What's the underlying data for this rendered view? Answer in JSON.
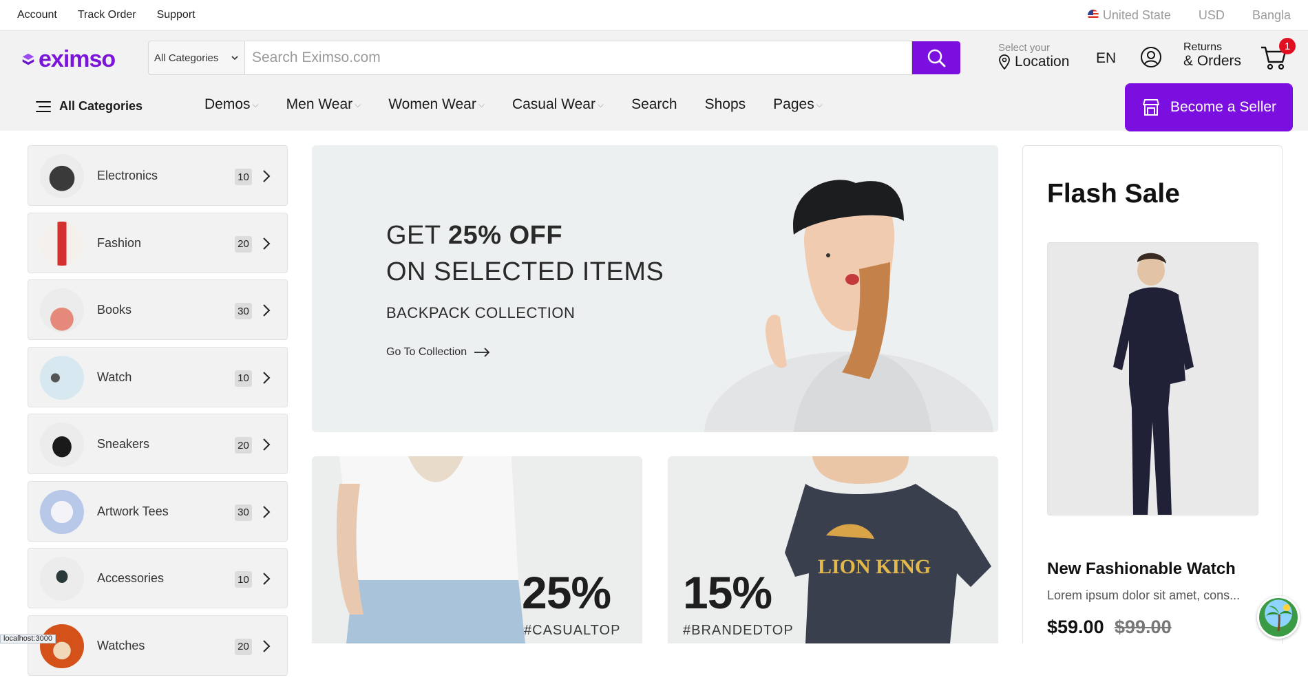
{
  "topbar": {
    "links": [
      "Account",
      "Track Order",
      "Support"
    ],
    "country": "United State",
    "currency": "USD",
    "language": "Bangla"
  },
  "header": {
    "logo_text": "eximso",
    "category_select": "All Categories",
    "search_placeholder": "Search Eximso.com",
    "location_small": "Select your",
    "location_big": "Location",
    "lang_code": "EN",
    "orders_small": "Returns",
    "orders_big": "& Orders",
    "cart_count": "1"
  },
  "nav": {
    "all_categories": "All Categories",
    "items": [
      "Demos",
      "Men Wear",
      "Women Wear",
      "Casual Wear",
      "Search",
      "Shops",
      "Pages"
    ],
    "seller_button": "Become a Seller"
  },
  "categories": [
    {
      "name": "Electronics",
      "count": "10"
    },
    {
      "name": "Fashion",
      "count": "20"
    },
    {
      "name": "Books",
      "count": "30"
    },
    {
      "name": "Watch",
      "count": "10"
    },
    {
      "name": "Sneakers",
      "count": "20"
    },
    {
      "name": "Artwork Tees",
      "count": "30"
    },
    {
      "name": "Accessories",
      "count": "10"
    },
    {
      "name": "Watches",
      "count": "20"
    }
  ],
  "hero": {
    "prefix": "GET",
    "offer": "25% OFF",
    "line2": "ON SELECTED ITEMS",
    "line3": "BACKPACK COLLECTION",
    "cta": "Go To Collection"
  },
  "promos": [
    {
      "percent": "25%",
      "tag": "#CASUALTOP"
    },
    {
      "percent": "15%",
      "tag": "#BRANDEDTOP"
    }
  ],
  "flash": {
    "title": "Flash Sale",
    "product_name": "New Fashionable Watch",
    "description": "Lorem ipsum dolor sit amet, cons...",
    "price": "$59.00",
    "old_price": "$99.00"
  },
  "status_url": "localhost:3000",
  "colors": {
    "brand": "#7b0fe0",
    "badge": "#e01022"
  }
}
